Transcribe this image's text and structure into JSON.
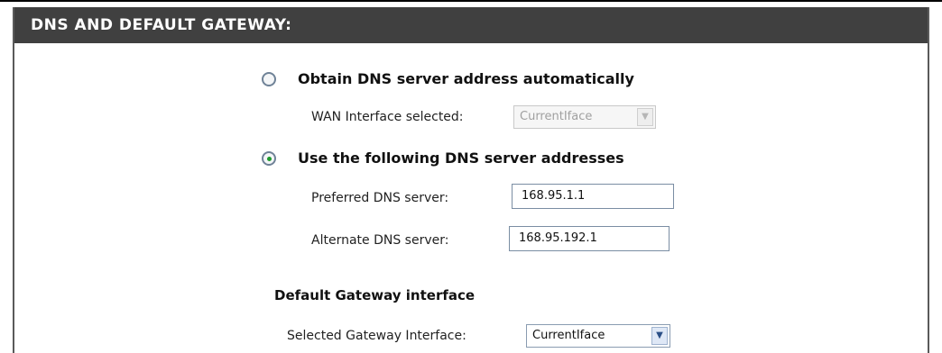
{
  "section": {
    "title": "DNS AND DEFAULT GATEWAY:"
  },
  "dns": {
    "auto_option": {
      "label": "Obtain DNS server address automatically",
      "selected": false
    },
    "wan_interface": {
      "label": "WAN Interface selected:",
      "value": "CurrentIface",
      "disabled": true
    },
    "manual_option": {
      "label": "Use the following DNS server addresses",
      "selected": true
    },
    "preferred": {
      "label": "Preferred DNS server:",
      "value": "168.95.1.1"
    },
    "alternate": {
      "label": "Alternate DNS server:",
      "value": "168.95.192.1"
    }
  },
  "gateway": {
    "title": "Default Gateway interface",
    "selected_label": "Selected Gateway Interface:",
    "selected_value": "CurrentIface"
  },
  "colors": {
    "header_bg": "#404040",
    "header_text": "#ffffff",
    "radio_selected": "#1f9a2e"
  },
  "icons": {
    "dropdown": "chevron-down-icon"
  }
}
